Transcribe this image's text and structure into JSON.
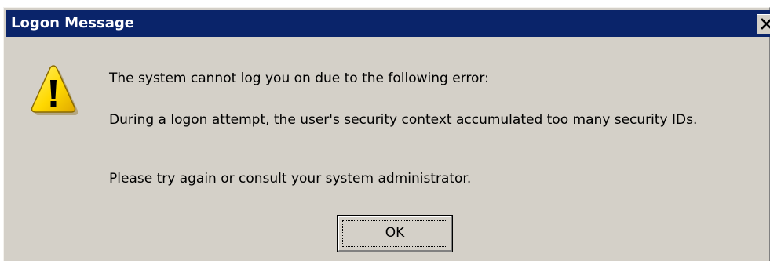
{
  "window": {
    "title": "Logon Message"
  },
  "icons": {
    "warning": "warning-icon",
    "close": "close-icon"
  },
  "message": {
    "line1": "The system cannot log you on due to the following error:",
    "line2": "During a logon attempt, the user's security context accumulated too many security IDs.",
    "line3": "Please try again or consult your system administrator."
  },
  "buttons": {
    "ok_label": "OK"
  },
  "colors": {
    "titlebar": "#0a246a",
    "dialog_face": "#d4d0c8",
    "warning_fill": "#ffd800"
  }
}
